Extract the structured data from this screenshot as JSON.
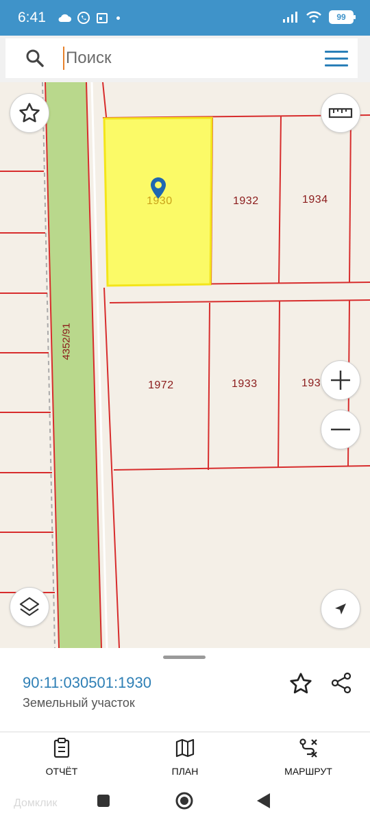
{
  "status_bar": {
    "time": "6:41",
    "battery": "99"
  },
  "search": {
    "placeholder": "Поиск"
  },
  "map": {
    "parcels": [
      {
        "label": "1930",
        "selected": true
      },
      {
        "label": "1932"
      },
      {
        "label": "1934"
      },
      {
        "label": "1972"
      },
      {
        "label": "1933"
      },
      {
        "label": "193"
      }
    ],
    "road_label": "4352/91",
    "colors": {
      "selected_fill": "#fbfa67",
      "selected_stroke": "#f3e51a",
      "boundary": "#d72c2c",
      "road": "#b9d88c",
      "background": "#f4efe7"
    },
    "icons": {
      "favorite": "star-icon",
      "ruler": "ruler-icon",
      "zoom_in": "plus-icon",
      "zoom_out": "minus-icon",
      "layers": "layers-icon",
      "locate": "navigation-arrow-icon",
      "pin": "location-pin-icon"
    }
  },
  "sheet": {
    "cadastral_number": "90:11:030501:1930",
    "type": "Земельный участок"
  },
  "bottom_nav": {
    "report": "ОТЧЁТ",
    "plan": "ПЛАН",
    "route": "МАРШРУТ"
  },
  "watermark": "Домклик",
  "accent_color": "#2e7fb5"
}
